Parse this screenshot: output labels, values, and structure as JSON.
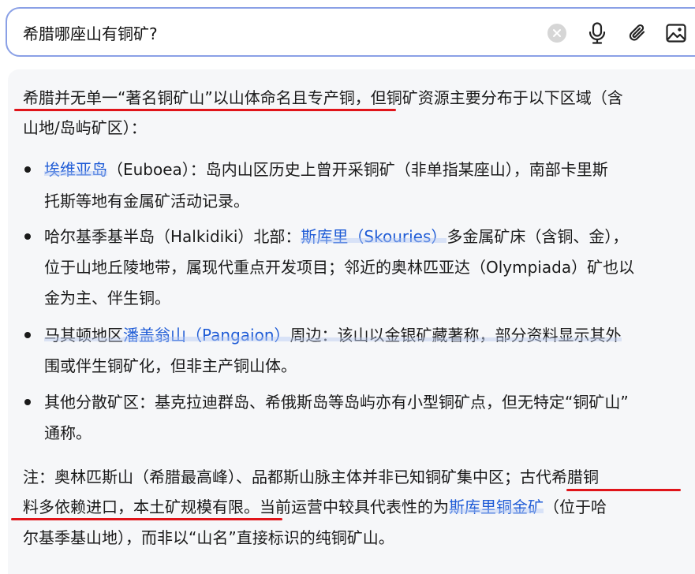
{
  "search": {
    "query": "希腊哪座山有铜矿?",
    "clear_icon": "clear-x-icon",
    "mic_icon": "microphone-icon",
    "attach_icon": "paperclip-icon",
    "image_icon": "image-icon"
  },
  "answer": {
    "intro_line1": "希腊并无单一“著名铜矿山”以山体命名且专产铜，但铜矿资源主要分布于以下区域（含",
    "intro_line2": "山地/岛屿矿区）：",
    "b1_link": "埃维亚岛",
    "b1_l1_rest": "（Euboea）：岛内山区历史上曾开采铜矿（非单指某座山），南部卡里斯",
    "b1_l2": "托斯等地有金属矿活动记录。",
    "b2_l1_pre": "哈尔基季基半岛（Halkidiki）北部：",
    "b2_link": "斯库里（Skouries）",
    "b2_l1_post": "多金属矿床（含铜、金），",
    "b2_l2": "位于山地丘陵地带，属现代重点开发项目；邻近的奥林匹亚达（Olympiada）矿也以",
    "b2_l3": "金为主、伴生铜。",
    "b3_l1_pre": "马其顿地区",
    "b3_link": "潘盖翁山（Pangaion）",
    "b3_l1_post": "周边：该山以金银矿藏著称，部分资料显示其外",
    "b3_l2": "围或伴生铜矿化，但非主产铜山体。",
    "b4_l1": "其他分散矿区：基克拉迪群岛、希俄斯岛等岛屿亦有小型铜矿点，但无特定“铜矿山”",
    "b4_l2": "通称。",
    "note_l1": "注：奥林匹斯山（希腊最高峰）、品都斯山脉主体并非已知铜矿集中区；古代希腊铜",
    "note_l2_pre": "料多依赖进口，本土矿规模有限。当前运营中较具代表性的为",
    "note_link": "斯库里铜金矿",
    "note_l2_post": "（位于哈",
    "note_l3": "尔基季基山地），而非以“山名”直接标识的纯铜矿山。"
  },
  "colors": {
    "link": "#1e5bd6",
    "annotation_red": "#e0141a",
    "search_border": "#8aa0e6",
    "answer_bg": "#f6f7f9"
  }
}
